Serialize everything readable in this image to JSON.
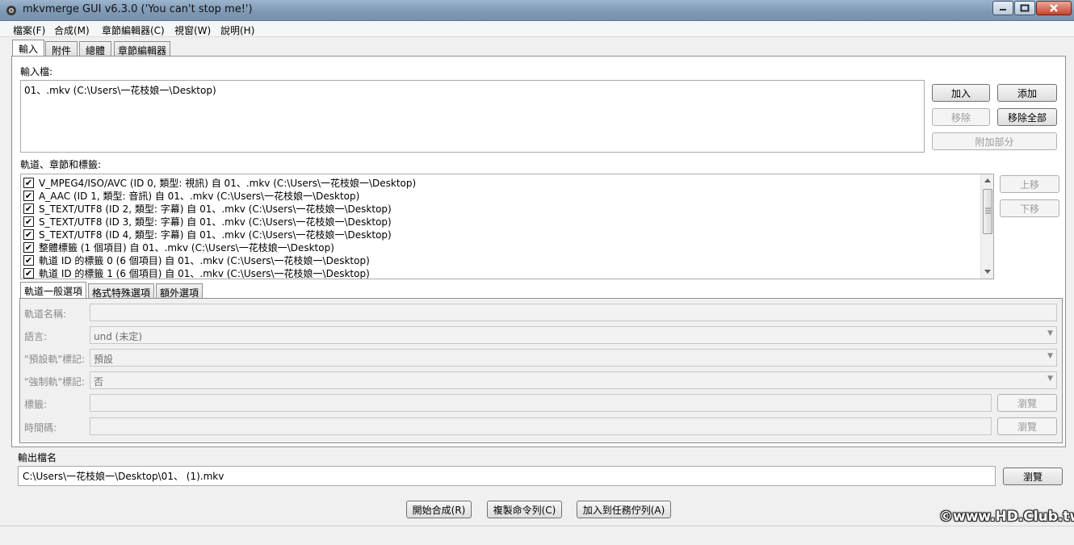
{
  "window": {
    "title": "mkvmerge GUI v6.3.0 ('You can't stop me!')"
  },
  "menu": [
    "檔案(F)",
    "合成(M)",
    "章節編輯器(C)",
    "視窗(W)",
    "說明(H)"
  ],
  "main_tabs": [
    "輸入",
    "附件",
    "總體",
    "章節編輯器"
  ],
  "input": {
    "label": "輸入檔:",
    "files": [
      "01、.mkv (C:\\Users\\一花枝娘一\\Desktop)"
    ],
    "buttons": {
      "add": "加入",
      "append": "添加",
      "remove": "移除",
      "remove_all": "移除全部",
      "additional_parts": "附加部分"
    }
  },
  "tracks": {
    "label": "軌道、章節和標籤:",
    "items": [
      {
        "checked": true,
        "text": "V_MPEG4/ISO/AVC (ID 0, 類型: 視訊) 自 01、.mkv (C:\\Users\\一花枝娘一\\Desktop)"
      },
      {
        "checked": true,
        "text": "A_AAC (ID 1, 類型: 音訊) 自 01、.mkv (C:\\Users\\一花枝娘一\\Desktop)"
      },
      {
        "checked": true,
        "text": "S_TEXT/UTF8 (ID 2, 類型: 字幕) 自 01、.mkv (C:\\Users\\一花枝娘一\\Desktop)"
      },
      {
        "checked": true,
        "text": "S_TEXT/UTF8 (ID 3, 類型: 字幕) 自 01、.mkv (C:\\Users\\一花枝娘一\\Desktop)"
      },
      {
        "checked": true,
        "text": "S_TEXT/UTF8 (ID 4, 類型: 字幕) 自 01、.mkv (C:\\Users\\一花枝娘一\\Desktop)"
      },
      {
        "checked": true,
        "text": "整體標籤 (1 個項目) 自 01、.mkv (C:\\Users\\一花枝娘一\\Desktop)"
      },
      {
        "checked": true,
        "text": "軌道 ID 的標籤 0 (6 個項目) 自 01、.mkv (C:\\Users\\一花枝娘一\\Desktop)"
      },
      {
        "checked": true,
        "text": "軌道 ID 的標籤 1 (6 個項目) 自 01、.mkv (C:\\Users\\一花枝娘一\\Desktop)"
      }
    ],
    "buttons": {
      "up": "上移",
      "down": "下移"
    },
    "check_mark": "✔"
  },
  "track_tabs": [
    "軌道一般選項",
    "格式特殊選項",
    "額外選項"
  ],
  "track_options": {
    "name_label": "軌道名稱:",
    "language_label": "語言:",
    "language_value": "und (未定)",
    "default_label": "\"預設軌\"標記:",
    "default_value": "預設",
    "forced_label": "\"強制軌\"標記:",
    "forced_value": "否",
    "tags_label": "標籤:",
    "timecodes_label": "時間碼:",
    "browse": "瀏覽"
  },
  "output": {
    "label": "輸出檔名",
    "value": "C:\\Users\\一花枝娘一\\Desktop\\01、 (1).mkv",
    "browse": "瀏覽"
  },
  "actions": {
    "start": "開始合成(R)",
    "copy_cmd": "複製命令列(C)",
    "add_job": "加入到任務佇列(A)"
  },
  "watermark": "©www.HD.Club.tw",
  "colors": {
    "titlebar": "#8aa3bf",
    "close": "#c6452b"
  }
}
